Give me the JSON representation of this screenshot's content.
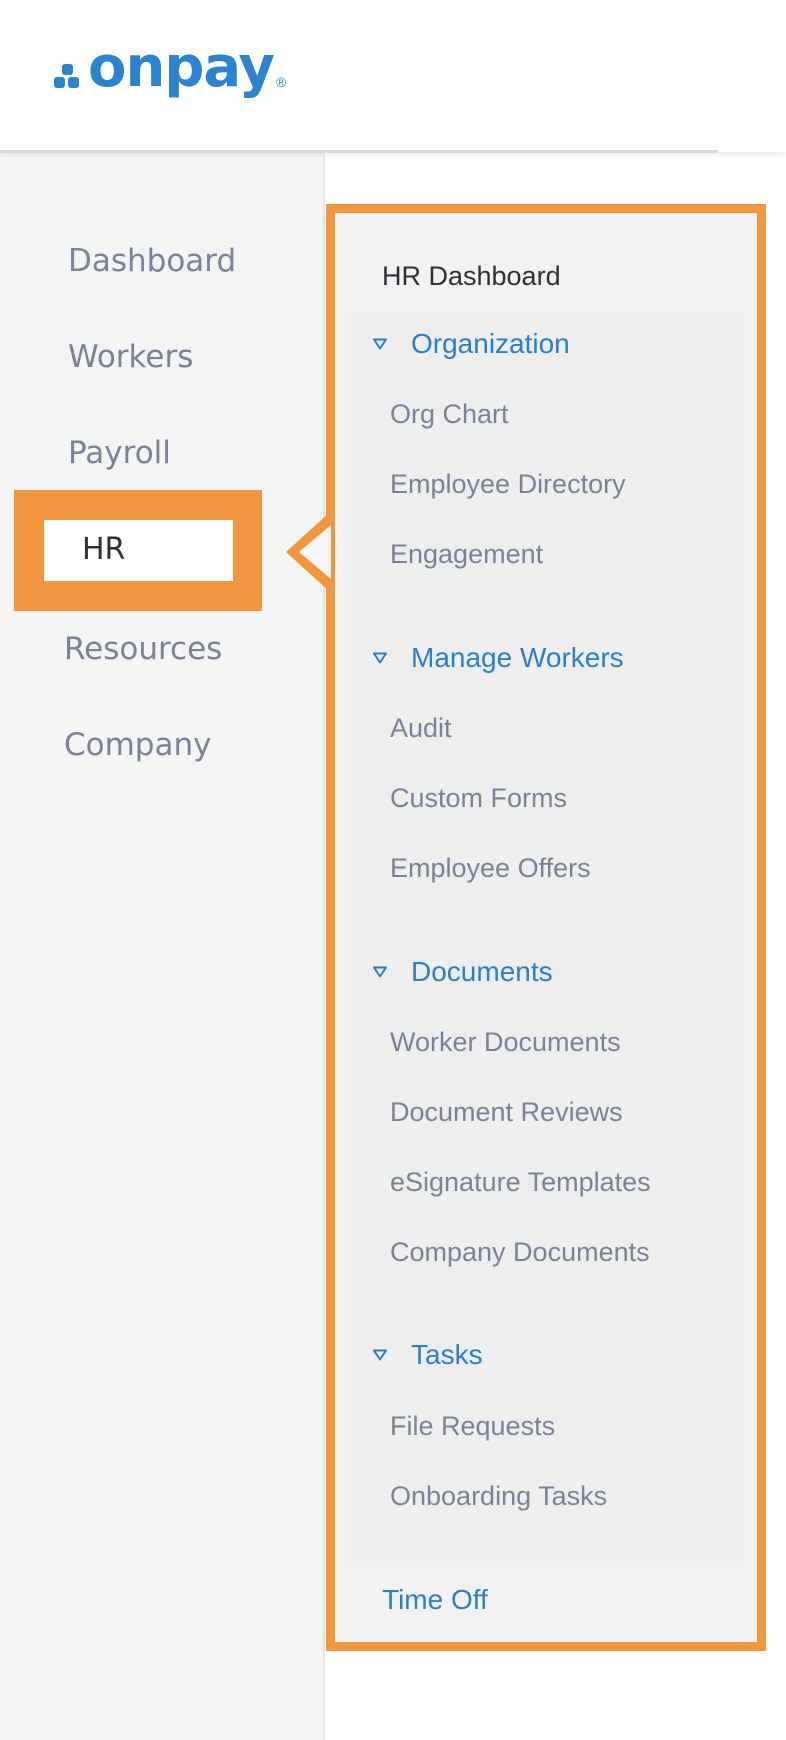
{
  "brand": {
    "name": "onpay",
    "registered": "®",
    "color": "#2b83cf"
  },
  "nav": {
    "items": [
      {
        "label": "Dashboard"
      },
      {
        "label": "Workers"
      },
      {
        "label": "Payroll"
      },
      {
        "label": "HR"
      },
      {
        "label": "Resources"
      },
      {
        "label": "Company"
      }
    ],
    "active": "HR",
    "highlight_color": "#f2963f"
  },
  "submenu": {
    "title": "HR Dashboard",
    "sections": [
      {
        "label": "Organization",
        "items": [
          "Org Chart",
          "Employee Directory",
          "Engagement"
        ]
      },
      {
        "label": "Manage Workers",
        "items": [
          "Audit",
          "Custom Forms",
          "Employee Offers"
        ]
      },
      {
        "label": "Documents",
        "items": [
          "Worker Documents",
          "Document Reviews",
          "eSignature Templates",
          "Company Documents"
        ]
      },
      {
        "label": "Tasks",
        "items": [
          "File Requests",
          "Onboarding Tasks"
        ]
      }
    ],
    "footer_link": "Time Off",
    "link_color": "#2b7fc6",
    "icon": "caret-down-icon"
  }
}
